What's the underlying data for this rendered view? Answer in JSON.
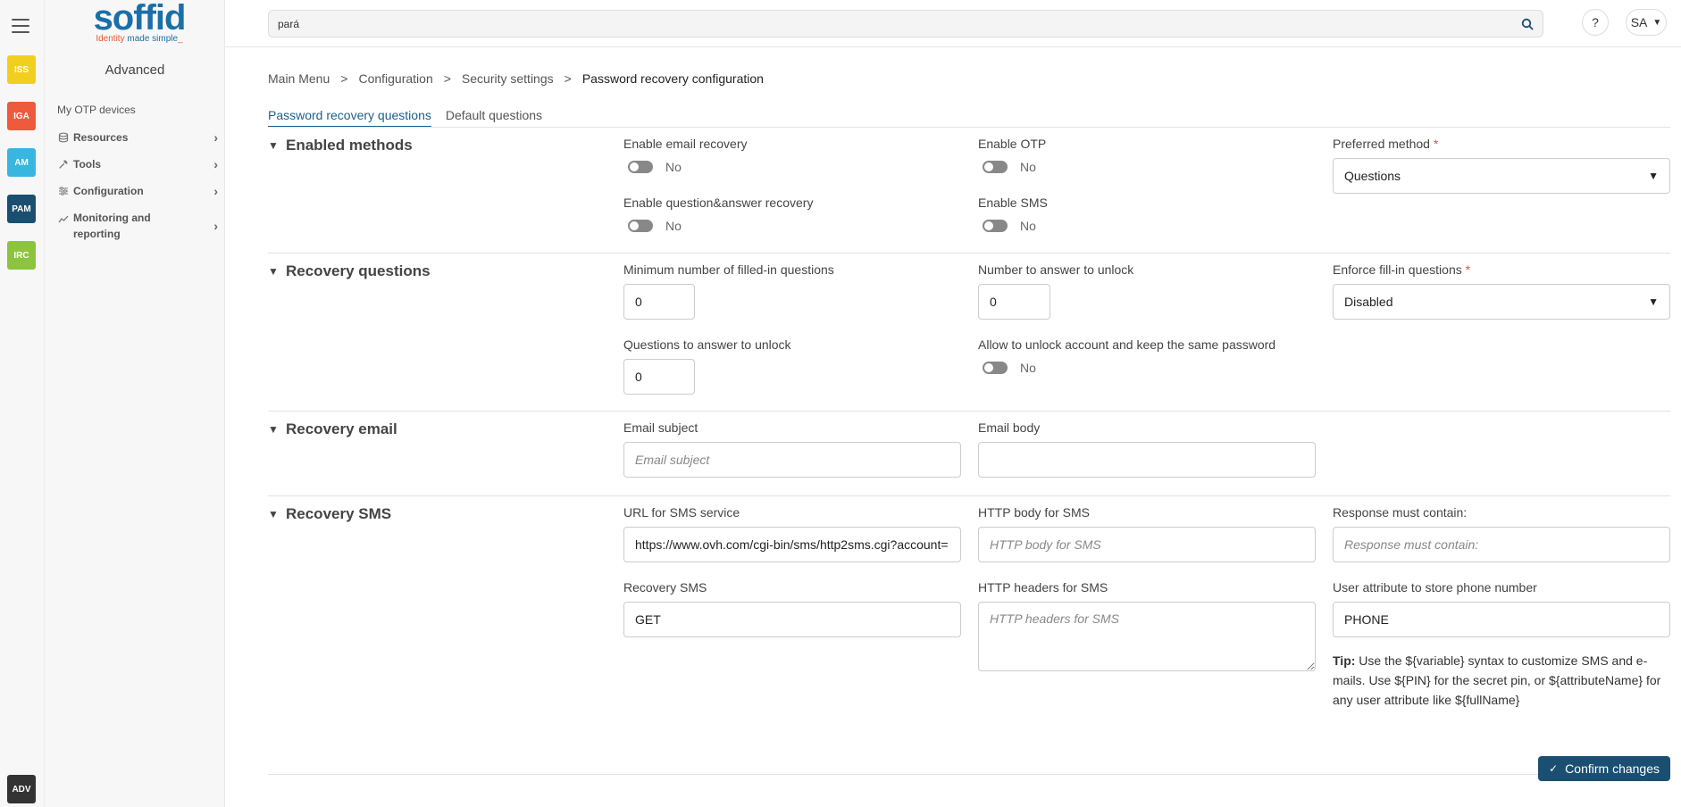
{
  "search": {
    "value": "pará"
  },
  "topbar": {
    "help_label": "?",
    "user_initials": "SA"
  },
  "logo": {
    "word": "soffid",
    "tag_a": "Identity ",
    "tag_b": "made simple",
    "tag_c": "_"
  },
  "rail": {
    "apps": [
      {
        "label": "ISS",
        "color": "#f2cf1f"
      },
      {
        "label": "IGA",
        "color": "#ee5a3c"
      },
      {
        "label": "AM",
        "color": "#37b6e0"
      },
      {
        "label": "PAM",
        "color": "#1b4f72"
      },
      {
        "label": "IRC",
        "color": "#8cc43f"
      }
    ],
    "adv": "ADV"
  },
  "sidebar": {
    "title": "Advanced",
    "link": "My OTP devices",
    "items": [
      {
        "label": "Resources",
        "icon": "database-icon"
      },
      {
        "label": "Tools",
        "icon": "wrench-icon"
      },
      {
        "label": "Configuration",
        "icon": "sliders-icon"
      },
      {
        "label": "Monitoring and reporting",
        "icon": "chart-line-icon"
      }
    ]
  },
  "breadcrumb": {
    "items": [
      "Main Menu",
      "Configuration",
      "Security settings"
    ],
    "current": "Password recovery configuration",
    "sep": ">"
  },
  "tabs": [
    "Password recovery questions",
    "Default questions"
  ],
  "sections": {
    "enabled": {
      "title": "Enabled methods",
      "email_label": "Enable email recovery",
      "email_value": "No",
      "otp_label": "Enable OTP",
      "otp_value": "No",
      "preferred_label": "Preferred method",
      "preferred_value": "Questions",
      "qa_label": "Enable question&answer recovery",
      "qa_value": "No",
      "sms_label": "Enable SMS",
      "sms_value": "No"
    },
    "questions": {
      "title": "Recovery questions",
      "min_label": "Minimum number of filled-in questions",
      "min_value": "0",
      "unlock_label": "Number to answer to unlock",
      "unlock_value": "0",
      "enforce_label": "Enforce fill-in questions",
      "enforce_value": "Disabled",
      "answer_label": "Questions to answer to unlock",
      "answer_value": "0",
      "keep_label": "Allow to unlock account and keep the same password",
      "keep_value": "No"
    },
    "email": {
      "title": "Recovery email",
      "subject_label": "Email subject",
      "subject_placeholder": "Email subject",
      "body_label": "Email body"
    },
    "sms": {
      "title": "Recovery SMS",
      "url_label": "URL for SMS service",
      "url_value": "https://www.ovh.com/cgi-bin/sms/http2sms.cgi?account=",
      "body_label": "HTTP body for SMS",
      "body_placeholder": "HTTP body for SMS",
      "resp_label": "Response must contain:",
      "resp_placeholder": "Response must contain:",
      "method_label": "Recovery SMS",
      "method_value": "GET",
      "headers_label": "HTTP headers for SMS",
      "headers_placeholder": "HTTP headers for SMS",
      "attr_label": "User attribute to store phone number",
      "attr_value": "PHONE",
      "tip_bold": "Tip:",
      "tip_text": " Use the ${variable} syntax to customize SMS and e-mails. Use ${PIN} for the secret pin, or ${attributeName} for any user attribute like ${fullName}"
    }
  },
  "confirm_label": "Confirm changes"
}
